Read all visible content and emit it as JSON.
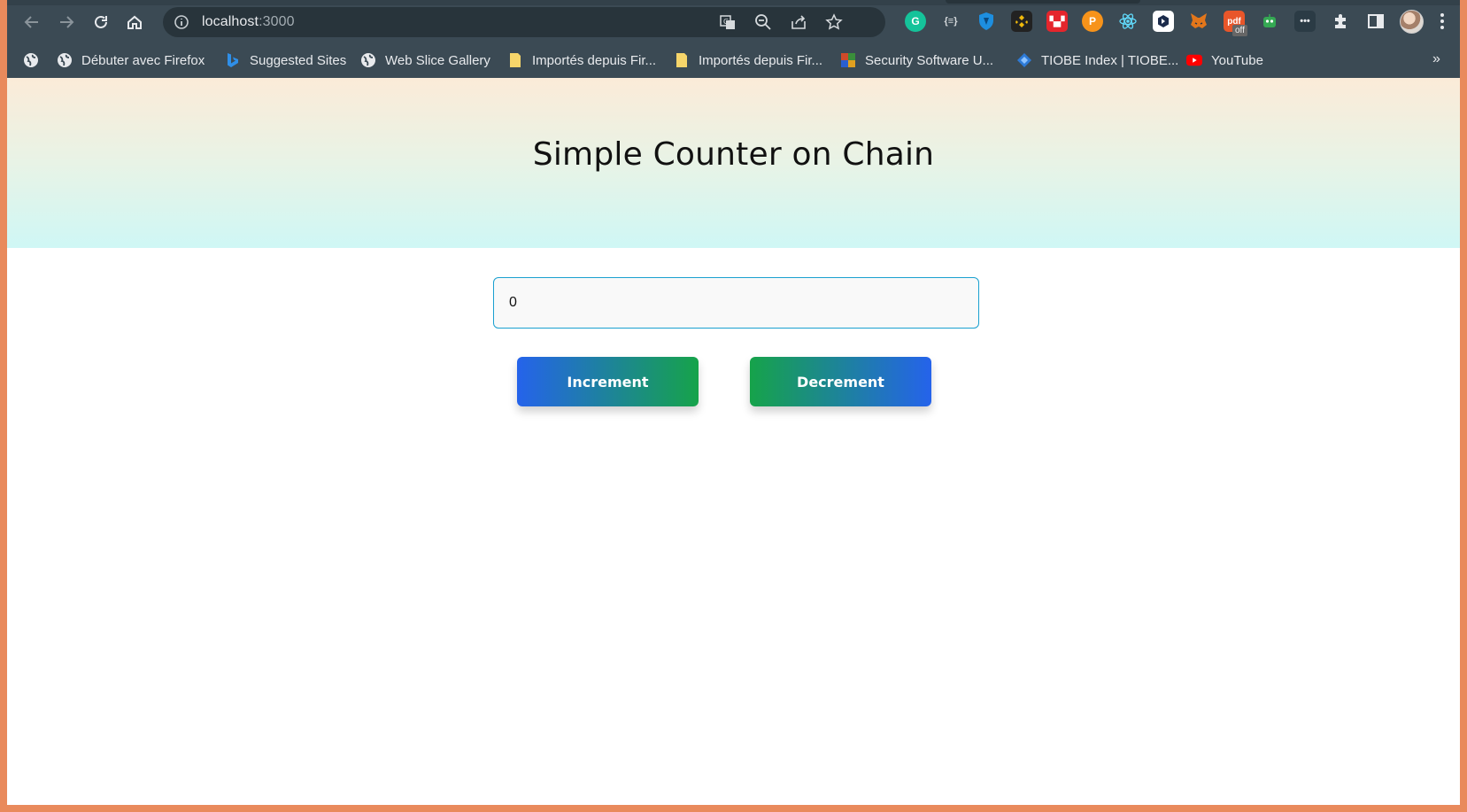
{
  "browser": {
    "url_host": "localhost",
    "url_port": ":3000",
    "bookmarks": [
      {
        "label": "Débuter avec Firefox",
        "icon": "globe-icon"
      },
      {
        "label": "Suggested Sites",
        "icon": "bing-icon"
      },
      {
        "label": "Web Slice Gallery",
        "icon": "globe-icon"
      },
      {
        "label": "Importés depuis Fir...",
        "icon": "folder-icon"
      },
      {
        "label": "Importés depuis Fir...",
        "icon": "folder-icon"
      },
      {
        "label": "Security Software U...",
        "icon": "site-favicon"
      },
      {
        "label": "TIOBE Index | TIOBE...",
        "icon": "tiobe-icon"
      },
      {
        "label": "YouTube",
        "icon": "youtube-icon"
      }
    ],
    "more_label": "»",
    "extension_badge": "off"
  },
  "page": {
    "title": "Simple Counter on Chain",
    "counter_value": "0",
    "increment_label": "Increment",
    "decrement_label": "Decrement"
  },
  "colors": {
    "accent_blue": "#2563eb",
    "accent_green": "#16a34a",
    "input_border": "#1aa0d0",
    "frame": "#e98a5c"
  }
}
